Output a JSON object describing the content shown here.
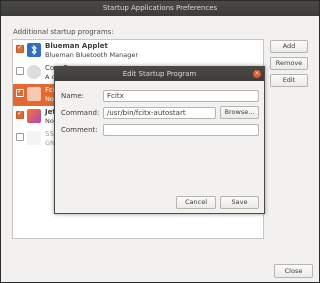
{
  "window": {
    "title": "Startup Applications Preferences"
  },
  "section_label": "Additional startup programs:",
  "programs": [
    {
      "title": "Blueman Applet",
      "subtitle": "Blueman Bluetooth Manager",
      "checked": true
    },
    {
      "title": "CopyQ",
      "subtitle": "A cut",
      "checked": false
    },
    {
      "title": "Fcitx",
      "subtitle": "No de",
      "checked": true
    },
    {
      "title": "JetB",
      "subtitle": "No de",
      "checked": true
    },
    {
      "title": "SSH",
      "subtitle": "GNOM",
      "checked": false
    }
  ],
  "buttons": {
    "add": "Add",
    "remove": "Remove",
    "edit": "Edit",
    "close": "Close"
  },
  "dialog": {
    "title": "Edit Startup Program",
    "close_glyph": "×",
    "name_label": "Name:",
    "name_value": "Fcitx",
    "command_label": "Command:",
    "command_value": "/usr/bin/fcitx-autostart",
    "comment_label": "Comment:",
    "comment_value": "",
    "browse": "Browse...",
    "cancel": "Cancel",
    "save": "Save"
  },
  "colors": {
    "accent": "#e2692f",
    "titlebar": "#3d3c38"
  }
}
